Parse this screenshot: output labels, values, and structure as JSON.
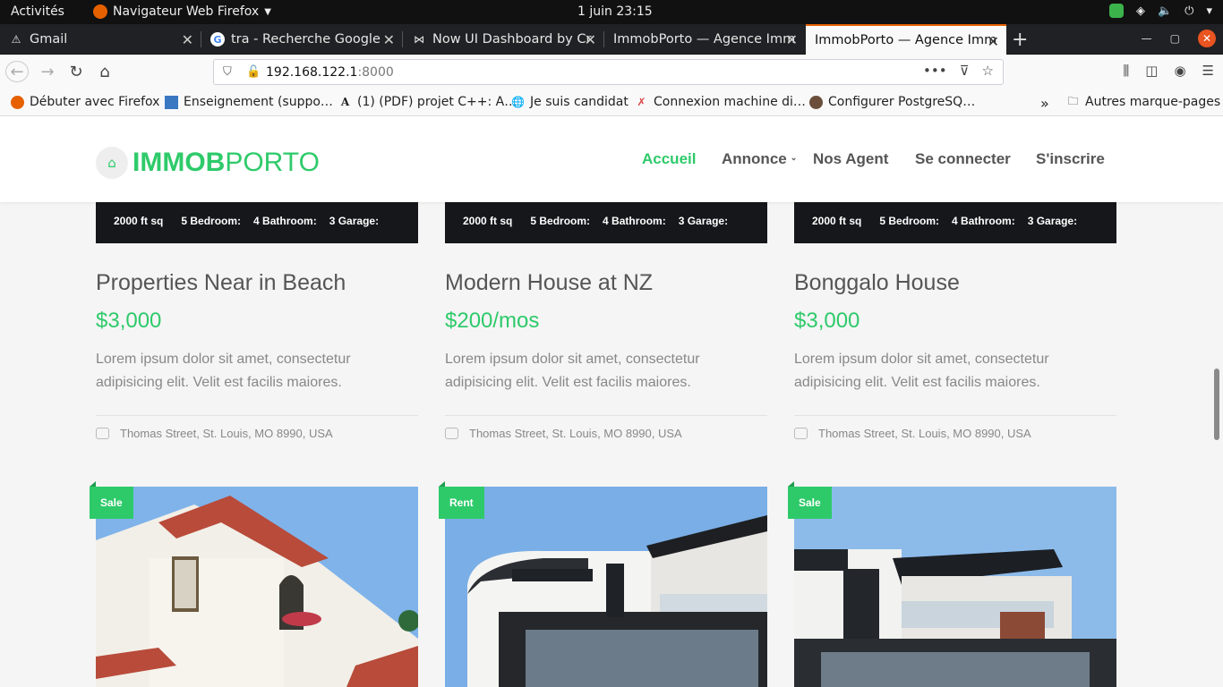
{
  "system_bar": {
    "activities": "Activités",
    "app_name": "Navigateur Web Firefox",
    "clock": "1 juin  23:15"
  },
  "tabs": [
    {
      "title": "Gmail",
      "icon": "warning-icon"
    },
    {
      "title": "tra - Recherche Google",
      "icon": "google-icon"
    },
    {
      "title": "Now UI Dashboard by Cr",
      "icon": "bowtie-icon"
    },
    {
      "title": "ImmobPorto — Agence Imm",
      "icon": "none"
    },
    {
      "title": "ImmobPorto — Agence Imm",
      "icon": "none",
      "active": true
    }
  ],
  "urlbar": {
    "host": "192.168.122.1",
    "port": ":8000"
  },
  "bookmarks": [
    {
      "label": "Débuter avec Firefox",
      "icon": "firefox-icon"
    },
    {
      "label": "Enseignement (suppo…",
      "icon": "book-icon"
    },
    {
      "label": "(1) (PDF) projet C++: A…",
      "icon": "academia-icon"
    },
    {
      "label": "Je suis candidat",
      "icon": "globe-icon"
    },
    {
      "label": "Connexion machine di…",
      "icon": "tool-icon"
    },
    {
      "label": "Configurer PostgreSQ…",
      "icon": "elephant-icon"
    }
  ],
  "bookmarks_other": "Autres marque-pages",
  "site": {
    "logo_a": "IMMOB",
    "logo_b": "PORTO",
    "nav": {
      "home": "Accueil",
      "annonce": "Annonce",
      "agents": "Nos Agent",
      "login": "Se connecter",
      "signup": "S'inscrire"
    }
  },
  "cards": [
    {
      "stats": [
        "2000 ft sq",
        "5 Bedroom:",
        "4 Bathroom:",
        "3 Garage:"
      ],
      "title": "Properties Near in Beach",
      "price": "$3,000",
      "description": "Lorem ipsum dolor sit amet, consectetur adipisicing elit. Velit est facilis maiores.",
      "address": "Thomas Street, St. Louis, MO 8990, USA"
    },
    {
      "stats": [
        "2000 ft sq",
        "5 Bedroom:",
        "4 Bathroom:",
        "3 Garage:"
      ],
      "title": "Modern House at NZ",
      "price": "$200/mos",
      "description": "Lorem ipsum dolor sit amet, consectetur adipisicing elit. Velit est facilis maiores.",
      "address": "Thomas Street, St. Louis, MO 8990, USA"
    },
    {
      "stats": [
        "2000 ft sq",
        "5 Bedroom:",
        "4 Bathroom:",
        "3 Garage:"
      ],
      "title": "Bonggalo House",
      "price": "$3,000",
      "description": "Lorem ipsum dolor sit amet, consectetur adipisicing elit. Velit est facilis maiores.",
      "address": "Thomas Street, St. Louis, MO 8990, USA"
    }
  ],
  "listings_next": [
    {
      "tag": "Sale"
    },
    {
      "tag": "Rent"
    },
    {
      "tag": "Sale"
    }
  ],
  "colors": {
    "brand_green": "#2eca6a",
    "firefox_orange": "#e66000"
  }
}
